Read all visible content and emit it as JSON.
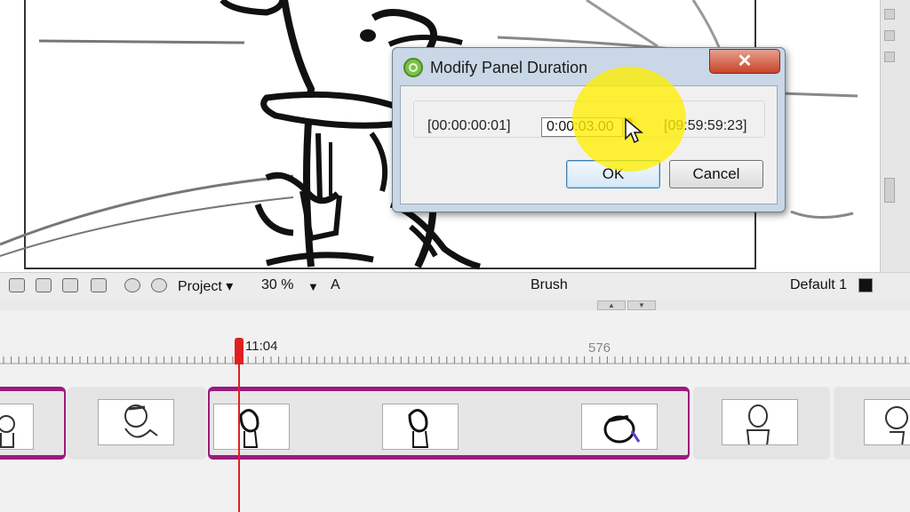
{
  "dialog": {
    "title": "Modify Panel Duration",
    "close_label": "✕",
    "min_value": "[00:00:00:01]",
    "duration_value": "0:00:03.00",
    "max_value": "[09:59:59:23]",
    "ok_label": "OK",
    "cancel_label": "Cancel"
  },
  "toolbar": {
    "view_mode": "Project",
    "zoom": "30 %",
    "zoom_suffix": "A",
    "tool": "Brush",
    "color_name": "Default 1",
    "color_swatch": "#111111"
  },
  "timeline": {
    "playhead_time": "11:04",
    "frame_marker": "576"
  },
  "colors": {
    "scene_accent": "#9c1a7d",
    "playhead": "#e02020",
    "dialog_frame": "#c9d7e6",
    "highlight": "#ffee00"
  }
}
